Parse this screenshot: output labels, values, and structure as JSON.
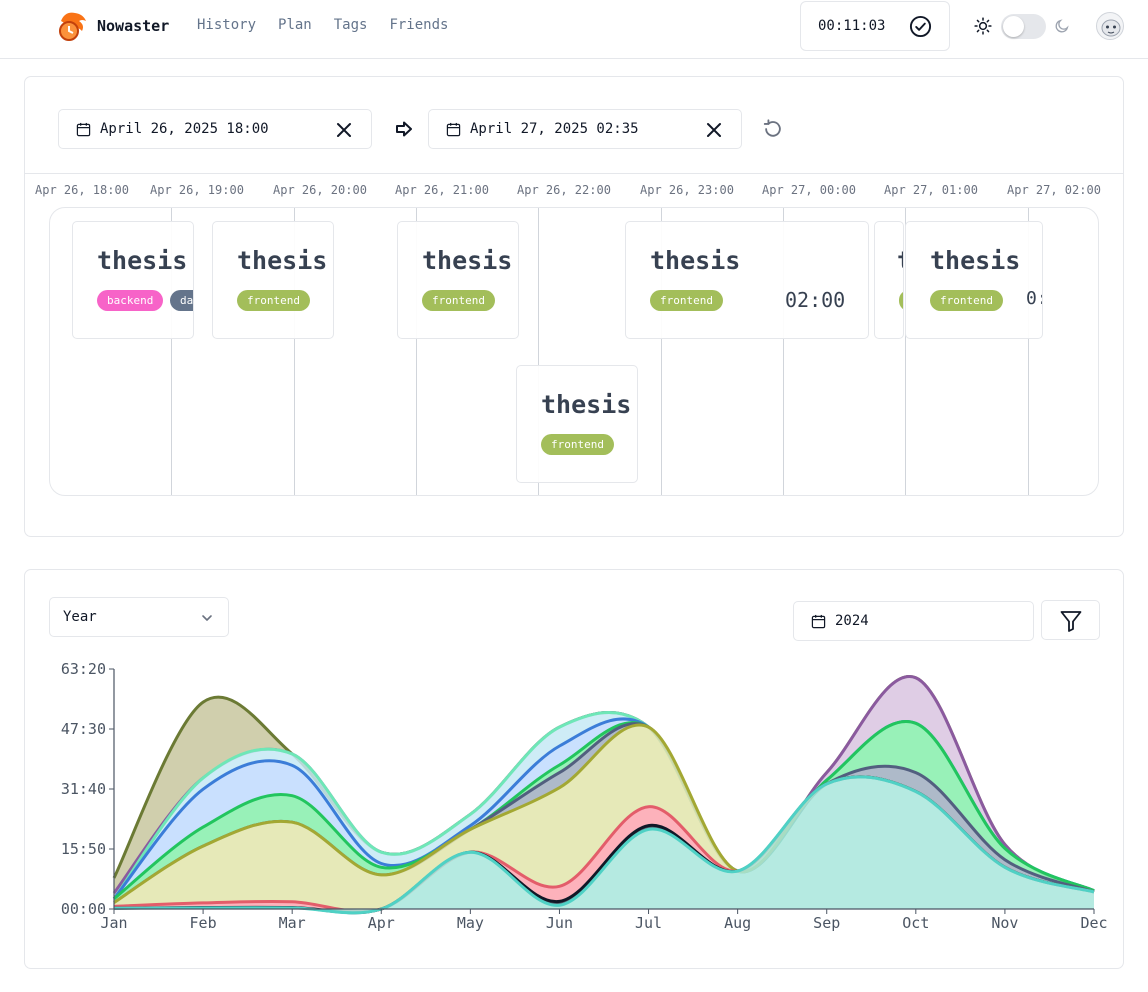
{
  "header": {
    "brand": "Nowaster",
    "nav": [
      "History",
      "Plan",
      "Tags",
      "Friends"
    ],
    "timer": "00:11:03",
    "icons": {
      "logo": "dragon-clock-logo",
      "check": "check-circle-icon",
      "theme_light": "sun-icon",
      "theme_dark": "moon-icon",
      "avatar": "user-avatar"
    },
    "dark_mode": false
  },
  "timeline": {
    "start": "April 26, 2025 18:00",
    "end": "April 27, 2025 02:35",
    "ticks": [
      "Apr 26, 18:00",
      "Apr 26, 19:00",
      "Apr 26, 20:00",
      "Apr 26, 21:00",
      "Apr 26, 22:00",
      "Apr 26, 23:00",
      "Apr 27, 00:00",
      "Apr 27, 01:00",
      "Apr 27, 02:00"
    ],
    "sessions": [
      {
        "title": "thesis",
        "tags": [
          "backend",
          "da"
        ]
      },
      {
        "title": "thesis",
        "tags": [
          "frontend"
        ]
      },
      {
        "title": "thesis",
        "tags": [
          "frontend"
        ]
      },
      {
        "title": "thesis",
        "tags": [
          "frontend"
        ]
      },
      {
        "title": "thesis",
        "tags": [
          "frontend"
        ],
        "time": "02:00"
      },
      {
        "title": "t",
        "tags": []
      },
      {
        "title": "thesis",
        "tags": [
          "frontend"
        ],
        "time": "0:"
      }
    ],
    "tag_colors": {
      "backend": "#f763c8",
      "da": "#64748b",
      "frontend": "#a3be5a"
    }
  },
  "chart_controls": {
    "granularity": "Year",
    "year": "2024",
    "filter_icon": "filter-icon"
  },
  "chart_data": {
    "type": "area",
    "stacked": true,
    "categories": [
      "Jan",
      "Feb",
      "Mar",
      "Apr",
      "May",
      "Jun",
      "Jul",
      "Aug",
      "Sep",
      "Oct",
      "Nov",
      "Dec"
    ],
    "y_tick_labels": [
      "00:00",
      "15:50",
      "31:40",
      "47:30",
      "63:20"
    ],
    "ylim": [
      0,
      63.33
    ],
    "series": [
      {
        "color": "#4fd1c5",
        "fill": "#a8e6dc",
        "values": [
          0.2,
          0.3,
          0.3,
          0,
          15,
          1,
          21,
          10,
          33,
          31,
          11,
          4.5
        ]
      },
      {
        "color": "#111827",
        "fill": "#374151",
        "values": [
          0,
          0.1,
          0.1,
          0,
          0,
          1,
          1,
          0,
          0,
          0,
          0,
          0
        ]
      },
      {
        "color": "#e35d6a",
        "fill": "#fda4af",
        "values": [
          0.5,
          1.2,
          1.5,
          0,
          0,
          4,
          5,
          0,
          0,
          0,
          0,
          0
        ]
      },
      {
        "color": "#a3a833",
        "fill": "#e2e5ab",
        "values": [
          1,
          15,
          21,
          9,
          6,
          26,
          21,
          0,
          0,
          0,
          0,
          0
        ]
      },
      {
        "color": "#525f7f",
        "fill": "#a0aec0",
        "values": [
          0,
          0,
          0,
          0,
          0,
          4,
          0,
          0,
          0,
          5,
          2,
          0
        ]
      },
      {
        "color": "#22c55e",
        "fill": "#86efac",
        "values": [
          1,
          5,
          7,
          2,
          0,
          2,
          0,
          0,
          1,
          13,
          3,
          0.3
        ]
      },
      {
        "color": "#3b7dd8",
        "fill": "#bfdbfe",
        "values": [
          0,
          10,
          8,
          1,
          1,
          5,
          0,
          0,
          0,
          0,
          0,
          0
        ]
      },
      {
        "color": "#6ee7b7",
        "fill": "#c5e9f5",
        "values": [
          0,
          3,
          3,
          3,
          3,
          5,
          0,
          0,
          0,
          0,
          0,
          0
        ]
      },
      {
        "color": "#8b5a9f",
        "fill": "#d9c4e0",
        "values": [
          1.5,
          0,
          0,
          0,
          0,
          0,
          0,
          0,
          2,
          12,
          1,
          0
        ]
      },
      {
        "color": "#6b7a34",
        "fill": "#c8c79f",
        "values": [
          4,
          20,
          0,
          0,
          0,
          0,
          0,
          0,
          0,
          0,
          0,
          0
        ]
      }
    ],
    "grid": false,
    "legend": "none"
  }
}
